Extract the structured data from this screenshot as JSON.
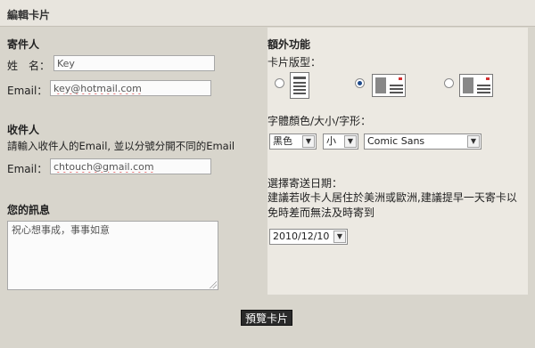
{
  "header": {
    "title": "編輯卡片"
  },
  "sender": {
    "section_title": "寄件人",
    "name_label": "姓　名：",
    "name_value": "Key",
    "email_label": "Email：",
    "email_value": "key@hotmail.com"
  },
  "recipient": {
    "section_title": "收件人",
    "instruction": "請輸入收件人的Email, 並以分號分開不同的Email",
    "email_label": "Email：",
    "email_value": "chtouch@gmail.com"
  },
  "message": {
    "section_title": "您的訊息",
    "text": "祝心想事成，事事如意"
  },
  "extras": {
    "section_title": "額外功能",
    "card_type_label": "卡片版型：",
    "card_types": [
      {
        "icon": "card-layout-portrait-icon",
        "selected": false
      },
      {
        "icon": "card-layout-landscape-icon",
        "selected": true
      },
      {
        "icon": "card-layout-landscape-alt-icon",
        "selected": false
      }
    ],
    "font_label": "字體顏色/大小/字形：",
    "font_color": "黑色",
    "font_size": "小",
    "font_family": "Comic Sans",
    "send_date_label": "選擇寄送日期：",
    "send_date_note": "建議若收卡人居住於美洲或歐洲,建議提早一天寄卡以免時差而無法及時寄到",
    "send_date_value": "2010/12/10"
  },
  "footer": {
    "preview_label": "預覽卡片"
  }
}
